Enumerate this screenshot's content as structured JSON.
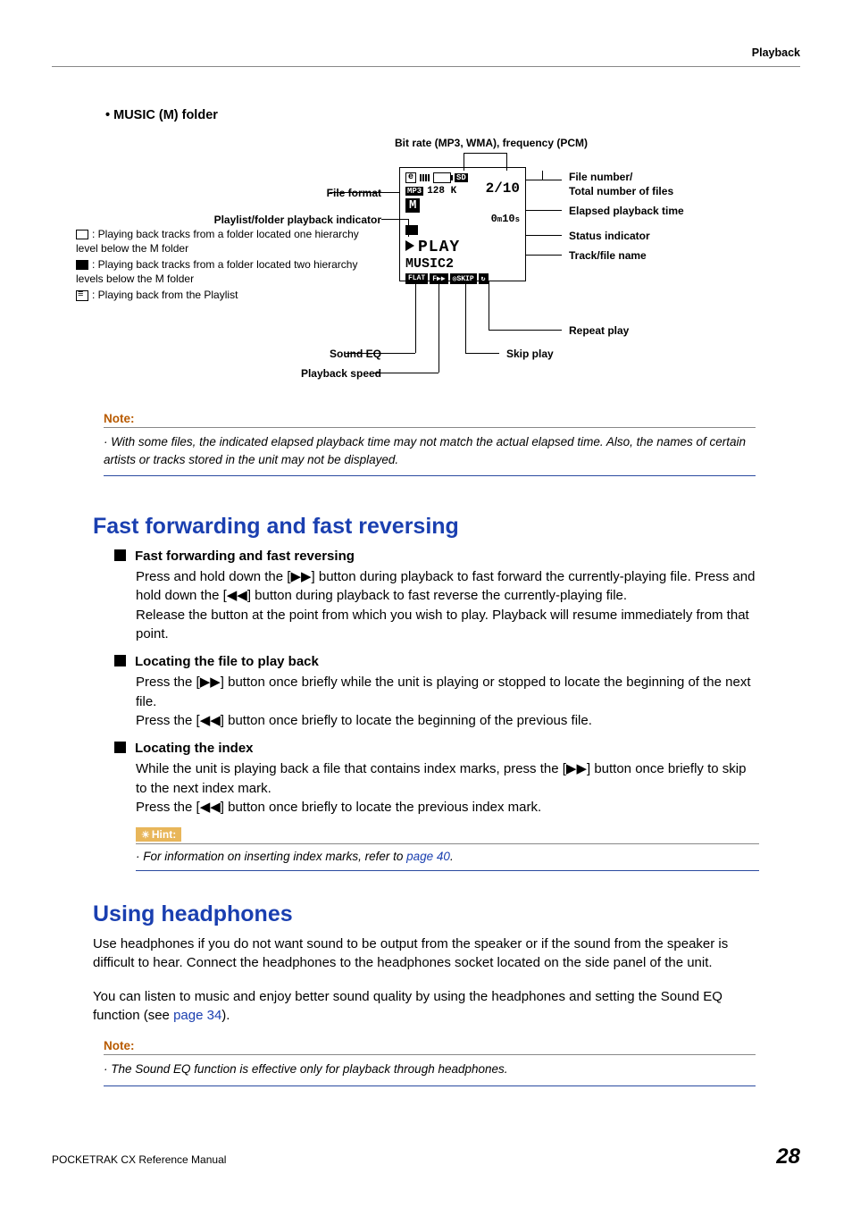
{
  "header": {
    "section": "Playback"
  },
  "musicFolder": {
    "title": "MUSIC (M) folder",
    "topLabel": "Bit rate (MP3, WMA), frequency (PCM)",
    "leftLabels": {
      "fileFormat": "File format",
      "playlistIndicator": "Playlist/folder playback indicator",
      "ind1": ": Playing back tracks from a folder located one hierarchy level below the M folder",
      "ind2": ": Playing back tracks from a folder located two hierarchy levels below the M folder",
      "ind3": ": Playing back from the Playlist",
      "soundEq": "Sound EQ",
      "playbackSpeed": "Playback speed"
    },
    "rightLabels": {
      "fileNumber": "File number/",
      "totalFiles": "Total number of files",
      "elapsed": "Elapsed playback time",
      "status": "Status indicator",
      "trackName": "Track/file name",
      "repeat": "Repeat play",
      "skip": "Skip play"
    },
    "lcd": {
      "rec": "e",
      "sd": "SD",
      "mp3": "MP3",
      "bitrate": "128 K",
      "mBadge": "M",
      "fraction": "2/10",
      "elapsed_min": "0",
      "elapsed_m": "m",
      "elapsed_sec": "10",
      "elapsed_s": "s",
      "play": "PLAY",
      "track": "MUSIC2",
      "chip1": "FLAT",
      "chip2": "F▶▶",
      "chip3": "◎SKIP",
      "chip4": "↻"
    }
  },
  "note1": {
    "label": "Note:",
    "text": "With some files, the indicated elapsed playback time may not match the actual elapsed time. Also, the names of certain artists or tracks stored in the unit may not be displayed."
  },
  "ffrev": {
    "heading": "Fast forwarding and fast reversing",
    "sub1": "Fast forwarding and fast reversing",
    "p1a": "Press and hold down the [",
    "ff": "▶▶",
    "p1b": "] button during playback to fast forward the currently-playing file. Press and hold down the [",
    "rw": "◀◀",
    "p1c": "] button during playback to fast reverse the currently-playing file.",
    "p1d": "Release the button at the point from which you wish to play. Playback will resume immediately from that point.",
    "sub2": "Locating the file to play back",
    "p2a": "Press the [",
    "p2b": "] button once briefly while the unit is playing or stopped to locate the beginning of the next file.",
    "p2c": "Press the [",
    "p2d": "] button once briefly to locate the beginning of the previous file.",
    "sub3": "Locating the index",
    "p3a": "While the unit is playing back a file that contains index marks, press the [",
    "p3b": "] button once briefly to skip to the next index mark.",
    "p3c": "Press the [",
    "p3d": "] button once briefly to locate the previous index mark."
  },
  "hint": {
    "label": "Hint:",
    "text": "For information on inserting index marks, refer to ",
    "link": "page 40",
    "after": "."
  },
  "headphones": {
    "heading": "Using headphones",
    "p1": "Use headphones if you do not want sound to be output from the speaker or if the sound from the speaker is difficult to hear. Connect the headphones to the headphones socket located on the side panel of the unit.",
    "p2a": "You can listen to music and enjoy better sound quality by using the headphones and setting the Sound EQ function (see ",
    "p2link": "page 34",
    "p2b": ")."
  },
  "note2": {
    "label": "Note:",
    "text": "The Sound EQ function is effective only for playback through headphones."
  },
  "footer": {
    "left": "POCKETRAK CX   Reference Manual",
    "page": "28"
  }
}
